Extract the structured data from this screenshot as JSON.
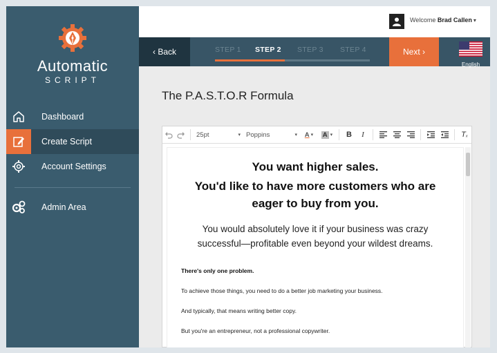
{
  "app": {
    "logo_title": "Automatic",
    "logo_sub": "SCRIPT"
  },
  "sidebar": {
    "items": [
      {
        "label": "Dashboard",
        "icon": "home-icon",
        "active": false
      },
      {
        "label": "Create Script",
        "icon": "edit-icon",
        "active": true
      },
      {
        "label": "Account Settings",
        "icon": "gear-icon",
        "active": false
      },
      {
        "label": "Admin Area",
        "icon": "gears-icon",
        "active": false
      }
    ]
  },
  "header": {
    "welcome": "Welcome",
    "user_name": "Brad Callen"
  },
  "stepbar": {
    "back_label": "‹ Back",
    "next_label": "Next ›",
    "steps": [
      "STEP 1",
      "STEP 2",
      "STEP 3",
      "STEP 4"
    ],
    "active_step": 2,
    "progress": 0.45,
    "language": "English"
  },
  "main": {
    "title": "The P.A.S.T.O.R Formula"
  },
  "toolbar": {
    "font_size": "25pt",
    "font_family": "Poppins"
  },
  "document": {
    "heading1": "You want higher sales.",
    "heading2": "You'd like to have more customers who are eager to buy from you.",
    "lead": "You would absolutely love it if your business was crazy successful—profitable even beyond your wildest dreams.",
    "bold_line": "There's only one problem.",
    "line1": "To achieve those things, you need to do a better job marketing your business.",
    "line2": "And typically, that means writing better copy.",
    "line3": "But you're an entrepreneur, not a professional copywriter."
  },
  "colors": {
    "sidebar": "#3a5c6e",
    "accent": "#e8703b",
    "stepbar": "#385566"
  }
}
